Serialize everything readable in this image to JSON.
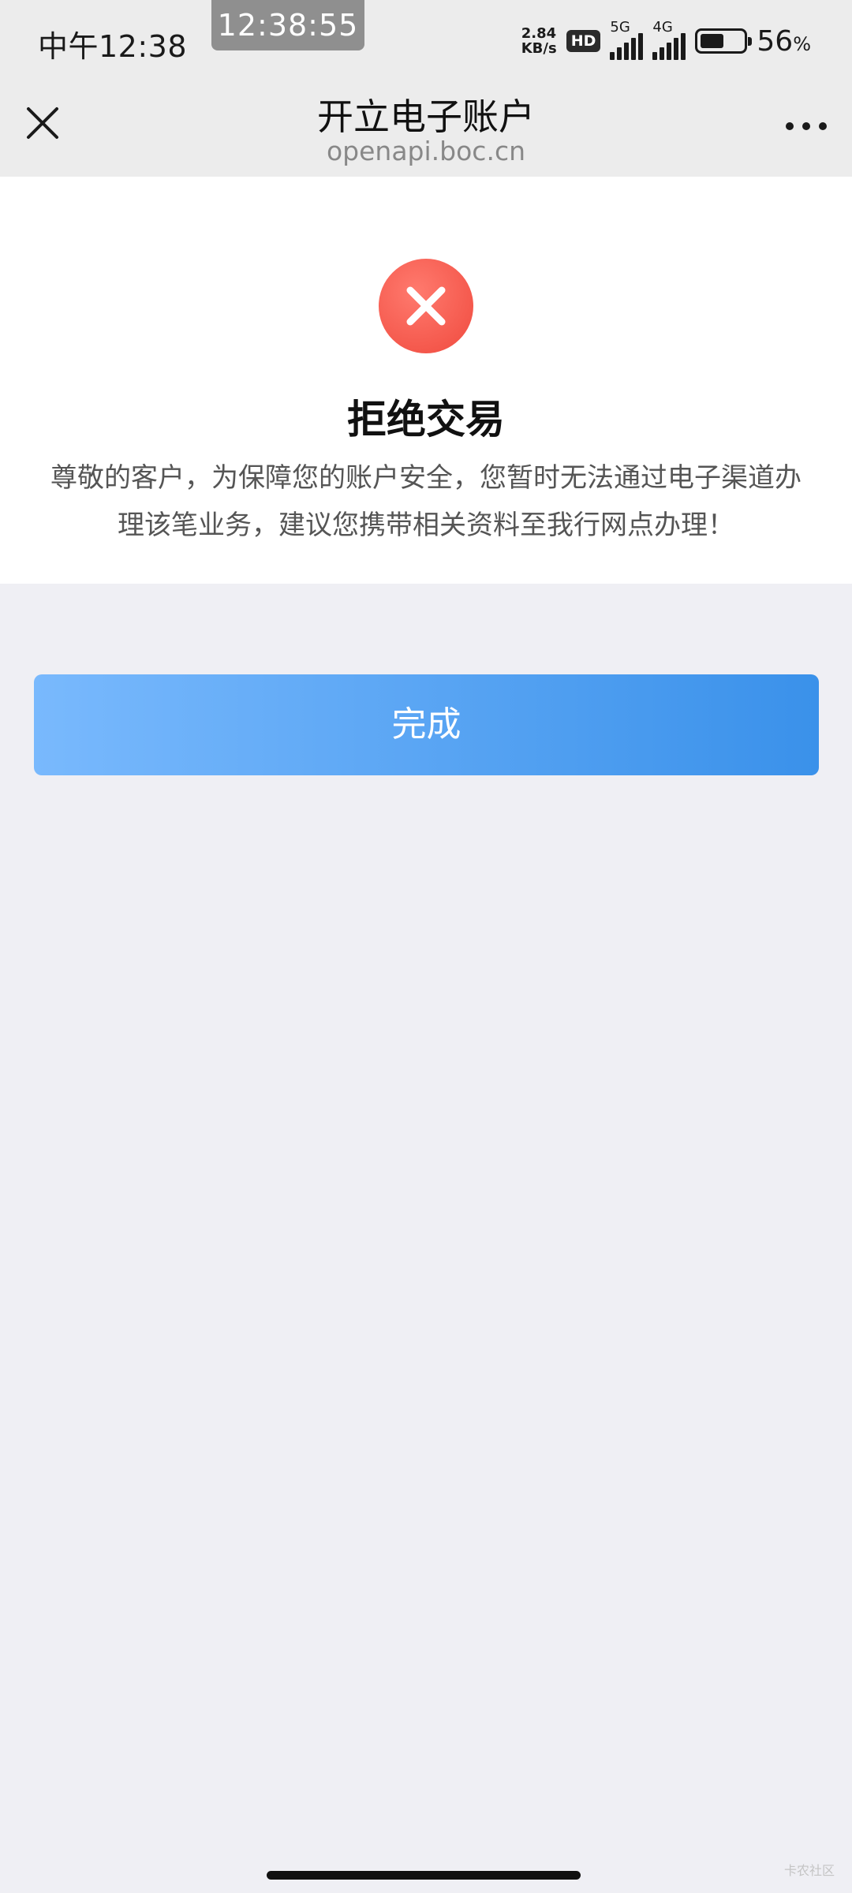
{
  "status_bar": {
    "time": "中午12:38",
    "clock_overlay": "12:38:55",
    "net_speed_value": "2.84",
    "net_speed_unit": "KB/s",
    "hd_badge": "HD",
    "sig_5g_label": "5G",
    "sig_4g_label": "4G",
    "battery_level": 0.56,
    "battery_value": "56",
    "battery_unit": "%"
  },
  "nav": {
    "title": "开立电子账户",
    "subtitle": "openapi.boc.cn",
    "close_icon": "close-icon",
    "more_icon": "more-dots-icon"
  },
  "result": {
    "icon": "error-x-icon",
    "icon_color": "#f04a3e",
    "title": "拒绝交易",
    "description": "尊敬的客户，为保障您的账户安全，您暂时无法通过电子渠道办理该笔业务，建议您携带相关资料至我行网点办理！"
  },
  "actions": {
    "done_label": "完成",
    "accent_color": "#3a91ea"
  },
  "watermark": "卡农社区"
}
